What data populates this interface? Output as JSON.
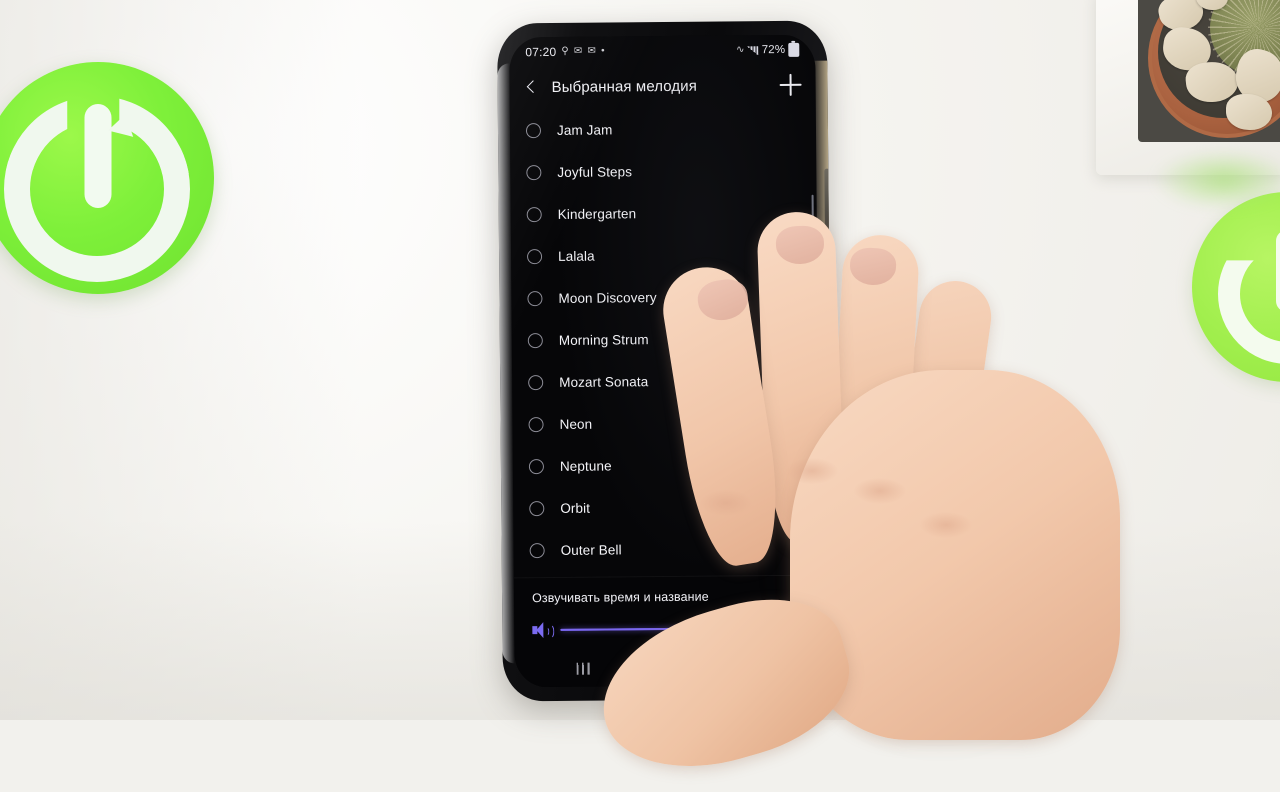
{
  "scene": {
    "background_color": "#f2f1ed",
    "objects": [
      {
        "name": "power-logo-left",
        "color": "#7ef03a"
      },
      {
        "name": "power-logo-right",
        "color": "#a2ef4e"
      },
      {
        "name": "cactus-planter",
        "color": "#a9613f"
      },
      {
        "name": "hand",
        "color": "#f2c8ab"
      }
    ]
  },
  "phone": {
    "status_bar": {
      "time": "07:20",
      "left_icons": [
        "send-icon",
        "mail-icon",
        "mail-icon",
        "dot-icon"
      ],
      "right_icons": [
        "wifi-icon",
        "signal-icon"
      ],
      "battery_percent": "72%",
      "battery_icon": "battery-icon"
    },
    "app_bar": {
      "back_icon": "back-chevron-icon",
      "title": "Выбранная мелодия",
      "add_icon": "plus-icon"
    },
    "ringtones": [
      {
        "label": "Jam Jam",
        "selected": false
      },
      {
        "label": "Joyful Steps",
        "selected": false
      },
      {
        "label": "Kindergarten",
        "selected": false
      },
      {
        "label": "Lalala",
        "selected": false
      },
      {
        "label": "Moon Discovery",
        "selected": false
      },
      {
        "label": "Morning Strum",
        "selected": false
      },
      {
        "label": "Mozart Sonata",
        "selected": false
      },
      {
        "label": "Neon",
        "selected": false
      },
      {
        "label": "Neptune",
        "selected": false
      },
      {
        "label": "Orbit",
        "selected": false
      },
      {
        "label": "Outer Bell",
        "selected": false
      }
    ],
    "bottom_panel": {
      "title": "Озвучивать время и название",
      "volume_icon": "volume-icon",
      "volume_percent": 95,
      "slider_color": "#7b68ee"
    },
    "nav_bar": {
      "recents_icon": "recents-icon",
      "home_icon": "home-icon",
      "back_icon": "back-icon"
    }
  }
}
